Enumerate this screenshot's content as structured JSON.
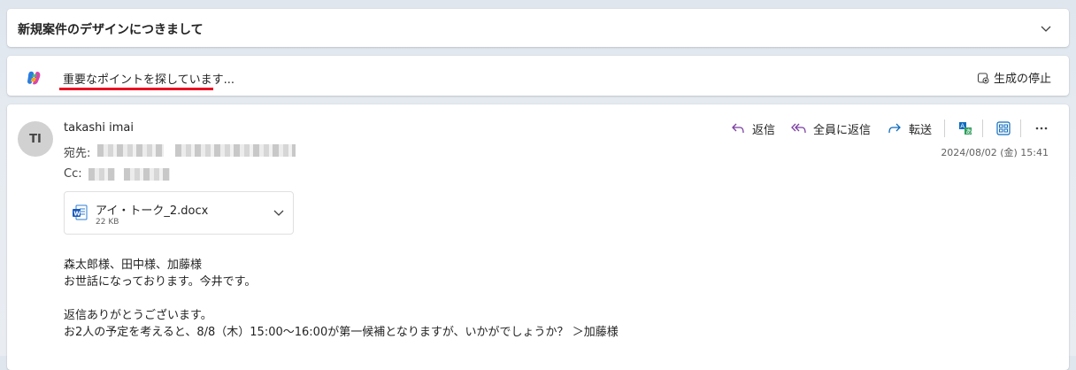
{
  "subject": "新規案件のデザインにつきまして",
  "copilot": {
    "status": "重要なポイントを探しています...",
    "stop_label": "生成の停止",
    "highlight_color": "#e81123"
  },
  "message": {
    "avatar_initials": "TI",
    "sender": "takashi imai",
    "to_label": "宛先:",
    "cc_label": "Cc:",
    "date": "2024/08/02 (金) 15:41",
    "actions": {
      "reply": "返信",
      "reply_all": "全員に返信",
      "forward": "転送"
    },
    "attachment": {
      "name": "アイ・トーク_2.docx",
      "size": "22 KB",
      "icon": "word-icon"
    },
    "body_lines": [
      "森太郎様、田中様、加藤様",
      "お世話になっております。今井です。",
      "",
      "返信ありがとうございます。",
      "お2人の予定を考えると、8/8（木）15:00～16:00が第一候補となりますが、いかがでしょうか？ ＞加藤様"
    ]
  },
  "colors": {
    "accent": "#0f6cbd",
    "reply_icon": "#7a3fa0",
    "forward_icon": "#0f6cbd"
  }
}
